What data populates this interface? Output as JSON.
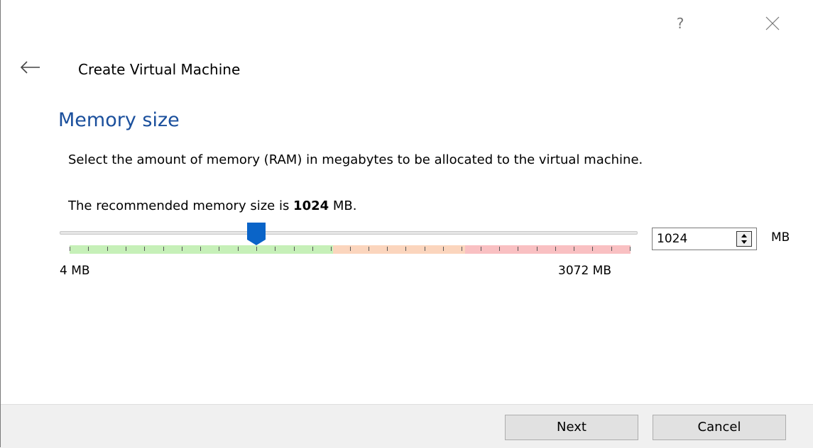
{
  "titlebar": {
    "help_label": "?"
  },
  "wizard": {
    "title": "Create Virtual Machine"
  },
  "page": {
    "heading": "Memory size",
    "description": "Select the amount of memory (RAM) in megabytes to be allocated to the virtual machine.",
    "recommend_prefix": "The recommended memory size is ",
    "recommend_value": "1024",
    "recommend_suffix": " MB."
  },
  "memory_slider": {
    "min_value_mb": 4,
    "max_value_mb": 3072,
    "current_value_mb": 1024,
    "min_label": "4 MB",
    "max_label": "3072 MB",
    "zone_fractions": {
      "green": 0.47,
      "orange": 0.235,
      "red": 0.295
    },
    "zone_colors": {
      "green": "#c6f0b8",
      "orange": "#fbd5bd",
      "red": "#f9c0c2"
    },
    "handle_color": "#0a64c8"
  },
  "spinbox": {
    "value": "1024",
    "unit": "MB"
  },
  "footer": {
    "next_label": "Next",
    "cancel_label": "Cancel"
  },
  "colors": {
    "heading": "#1a4f9c",
    "footer_bg": "#f0f0f0",
    "button_bg": "#e1e1e1"
  }
}
